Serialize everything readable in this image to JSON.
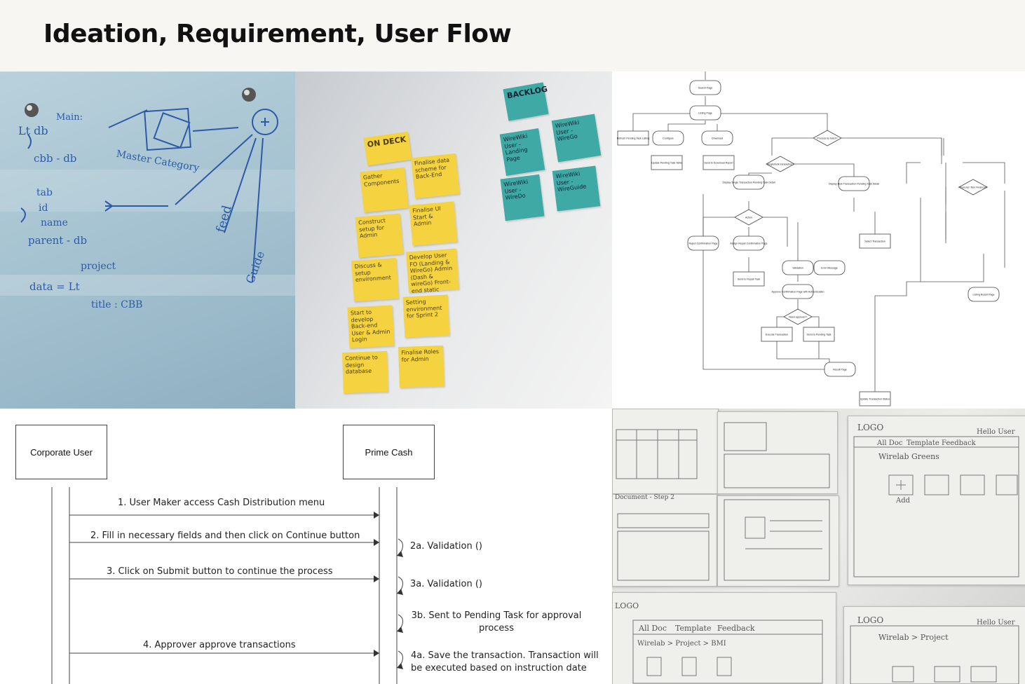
{
  "header": {
    "title": "Ideation, Requirement, User Flow"
  },
  "colors": {
    "sticky_yellow": "#f5d340",
    "sticky_teal": "#3fa9a6",
    "marker_blue": "#2d5aa8"
  },
  "whiteboard": {
    "lines": [
      "Main:",
      "Lt db",
      "cbb - db",
      "tab",
      "id",
      "name",
      "parent - db",
      "project",
      "data = Lt",
      "title : CBB",
      "Master Category",
      "feed",
      "Guide"
    ]
  },
  "wall": {
    "ondeck_label": "ON DECK",
    "backlog_label": "BACKLOG",
    "yellow_notes": [
      "Gather Components",
      "Finalise data scheme for Back-End",
      "Construct setup for Admin",
      "Finalise UI Start & Admin",
      "Discuss & setup environment",
      "Develop User FO (Landing & WireGo) Admin (Dash & wireGo) Front-end static",
      "Start to develop Back-end User & Admin Login",
      "Setting environment for Sprint 2",
      "Continue to design database",
      "Finalise Roles for Admin"
    ],
    "teal_notes": [
      "WireWiki User - Landing Page",
      "WireWiki User - WireGo",
      "WireWiki User - WireDo",
      "WireWiki User - WireGuide"
    ]
  },
  "flow": {
    "nodes": [
      "Search Page",
      "Listing Page",
      "Refresh Pending Task Listing",
      "Configure",
      "Download",
      "Process by batch?",
      "Save Configuration",
      "Update Pending Task Table",
      "Send to Download Report",
      "Single/bulk transaction?",
      "Action",
      "Display Single Transaction Pending Task Detail",
      "Display Bulk Transaction Pending Task Detail",
      "Reject Confirmation Page",
      "Assign Repair Confirmation Page",
      "Send to Repair Task",
      "Validation",
      "Error Message",
      "Approve Confirmation Page with Authentication",
      "Need approver?",
      "Execute Transaction",
      "Send to Pending Task",
      "Result Page",
      "Update Transaction Status",
      "Select Transaction",
      "Financial / Non Financial?",
      "Listing Result Page"
    ]
  },
  "sequence": {
    "actors": [
      "Corporate User",
      "Prime Cash"
    ],
    "messages": [
      "1. User Maker access Cash Distribution menu",
      "2. Fill in necessary fields and then click on Continue button",
      "3. Click on Submit button to continue the process",
      "4. Approver approve transactions"
    ],
    "self_calls": [
      "2a. Validation ()",
      "3a. Validation ()",
      "3b. Sent to Pending Task for approval process",
      "4a. Save the transaction. Transaction will be executed based on instruction date"
    ]
  },
  "sketch": {
    "texts": [
      "LOGO",
      "Hello User",
      "All Doc",
      "Template",
      "Feedback",
      "Wirelab Greens",
      "Add",
      "LOGO",
      "Hello User",
      "Wirelab > Project",
      "Document - Step 2",
      "LOGO",
      "All Doc",
      "Template",
      "Feedback",
      "Wirelab > Project > BMI"
    ]
  }
}
